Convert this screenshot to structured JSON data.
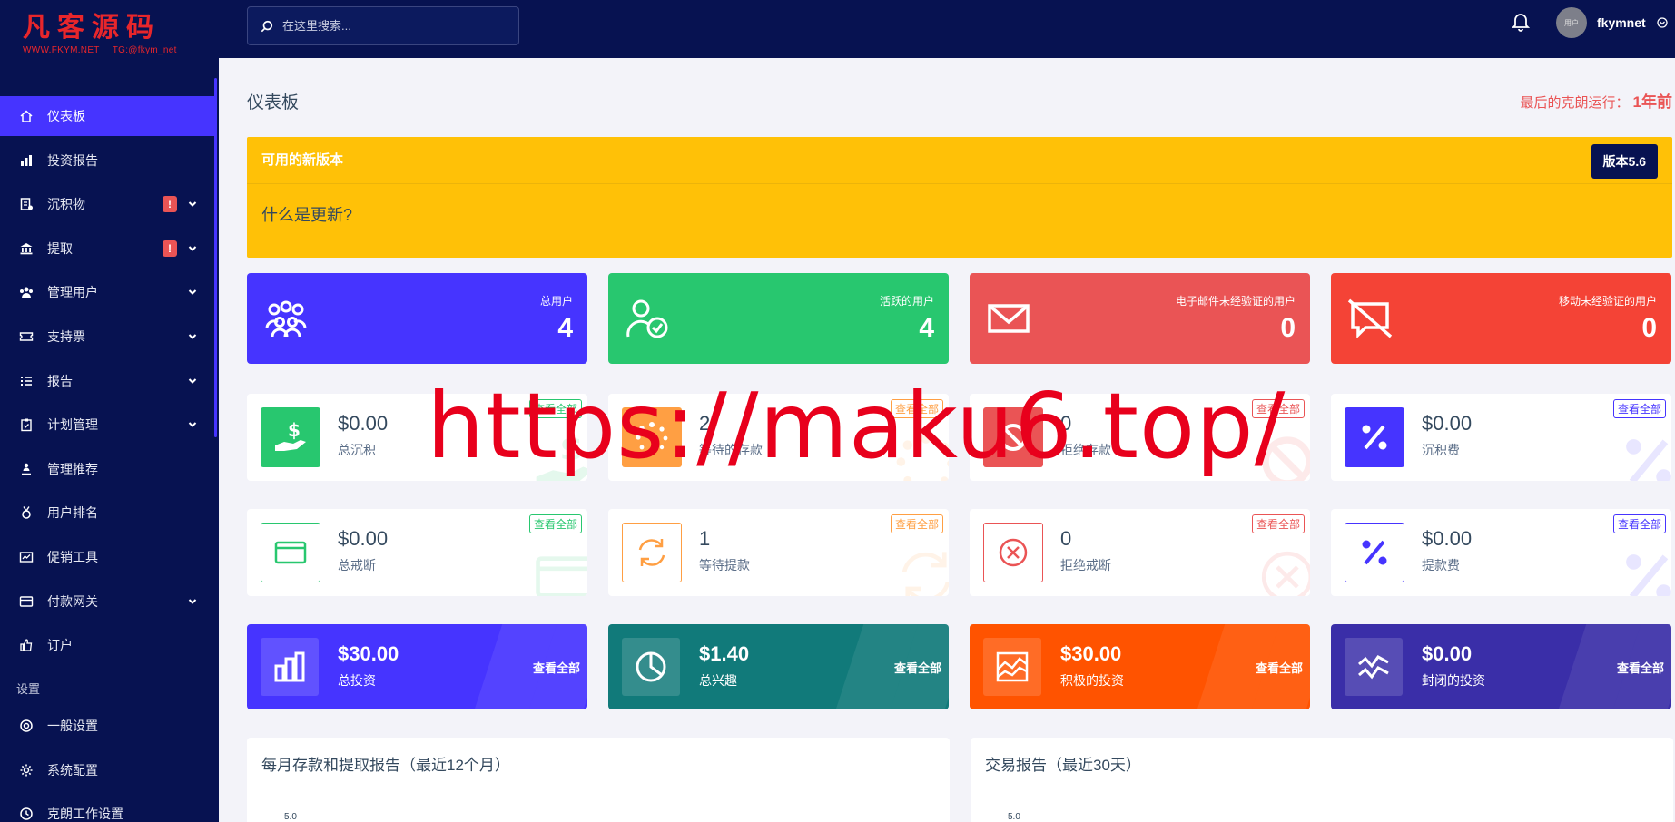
{
  "logo": {
    "title": "凡客源码",
    "site": "WWW.FKYM.NET",
    "tg": "TG:@fkym_net"
  },
  "search": {
    "placeholder": "在这里搜索..."
  },
  "user": {
    "name": "fkymnet",
    "avatar_text": "用户"
  },
  "sidebar": {
    "items": [
      {
        "label": "仪表板",
        "icon": "home-icon",
        "active": true
      },
      {
        "label": "投资报告",
        "icon": "bar-chart-icon"
      },
      {
        "label": "沉积物",
        "icon": "deposit-icon",
        "alert": "!",
        "chevron": true
      },
      {
        "label": "提取",
        "icon": "bank-icon",
        "alert": "!",
        "chevron": true
      },
      {
        "label": "管理用户",
        "icon": "users-icon",
        "chevron": true
      },
      {
        "label": "支持票",
        "icon": "ticket-icon",
        "chevron": true
      },
      {
        "label": "报告",
        "icon": "list-icon",
        "chevron": true
      },
      {
        "label": "计划管理",
        "icon": "clipboard-icon",
        "chevron": true
      },
      {
        "label": "管理推荐",
        "icon": "referral-icon"
      },
      {
        "label": "用户排名",
        "icon": "medal-icon"
      },
      {
        "label": "促销工具",
        "icon": "promo-icon"
      },
      {
        "label": "付款网关",
        "icon": "card-icon",
        "chevron": true
      },
      {
        "label": "订户",
        "icon": "thumbs-up-icon"
      }
    ],
    "section_label": "设置",
    "settings_items": [
      {
        "label": "一般设置",
        "icon": "settings-circle-icon"
      },
      {
        "label": "系统配置",
        "icon": "gear-icon"
      },
      {
        "label": "克朗工作设置",
        "icon": "clock-icon"
      }
    ]
  },
  "page": {
    "title": "仪表板",
    "cron_label": "最后的克朗运行：",
    "cron_value": "1年前"
  },
  "banner": {
    "title": "可用的新版本",
    "version": "版本5.6",
    "body": "什么是更新?"
  },
  "big_cards": [
    {
      "label": "总用户",
      "value": "4",
      "color": "#4634ff",
      "icon": "users-group-icon"
    },
    {
      "label": "活跃的用户",
      "value": "4",
      "color": "#28c76f",
      "icon": "user-check-icon"
    },
    {
      "label": "电子邮件未经验证的用户",
      "value": "0",
      "color": "#ea5455",
      "icon": "envelope-icon"
    },
    {
      "label": "移动未经验证的用户",
      "value": "0",
      "color": "#f44336",
      "icon": "message-slash-icon"
    }
  ],
  "white_cards_row1": [
    {
      "value": "$0.00",
      "label": "总沉积",
      "view": "查看全部",
      "color": "#28c76f",
      "filled": true,
      "icon": "hand-dollar-icon"
    },
    {
      "value": "2",
      "label": "等待的存款",
      "view": "查看全部",
      "color": "#ff9f43",
      "filled": true,
      "icon": "spinner-icon"
    },
    {
      "value": "0",
      "label": "拒绝存款",
      "view": "查看全部",
      "color": "#ea5455",
      "filled": true,
      "icon": "ban-icon"
    },
    {
      "value": "$0.00",
      "label": "沉积费",
      "view": "查看全部",
      "color": "#4634ff",
      "filled": true,
      "icon": "percent-icon"
    }
  ],
  "white_cards_row2": [
    {
      "value": "$0.00",
      "label": "总戒断",
      "view": "查看全部",
      "color": "#28c76f",
      "filled": false,
      "icon": "wallet-card-icon"
    },
    {
      "value": "1",
      "label": "等待提款",
      "view": "查看全部",
      "color": "#ff9f43",
      "filled": false,
      "icon": "sync-icon"
    },
    {
      "value": "0",
      "label": "拒绝戒断",
      "view": "查看全部",
      "color": "#ea5455",
      "filled": false,
      "icon": "x-circle-icon"
    },
    {
      "value": "$0.00",
      "label": "提款费",
      "view": "查看全部",
      "color": "#4634ff",
      "filled": false,
      "icon": "percent-icon"
    }
  ],
  "color_cards": [
    {
      "value": "$30.00",
      "label": "总投资",
      "view": "查看全部",
      "color": "#4634ff",
      "icon": "bar-chart-icon"
    },
    {
      "value": "$1.40",
      "label": "总兴趣",
      "view": "查看全部",
      "color": "#117a7a",
      "icon": "pie-chart-icon"
    },
    {
      "value": "$30.00",
      "label": "积极的投资",
      "view": "查看全部",
      "color": "#ff5300",
      "icon": "area-chart-icon"
    },
    {
      "value": "$0.00",
      "label": "封闭的投资",
      "view": "查看全部",
      "color": "#3a2ea8",
      "icon": "wave-chart-icon"
    }
  ],
  "reports": [
    {
      "title": "每月存款和提取报告（最近12个月）",
      "tick": "5.0"
    },
    {
      "title": "交易报告（最近30天）",
      "tick": "5.0"
    }
  ],
  "watermark": "https://maku6.top/"
}
